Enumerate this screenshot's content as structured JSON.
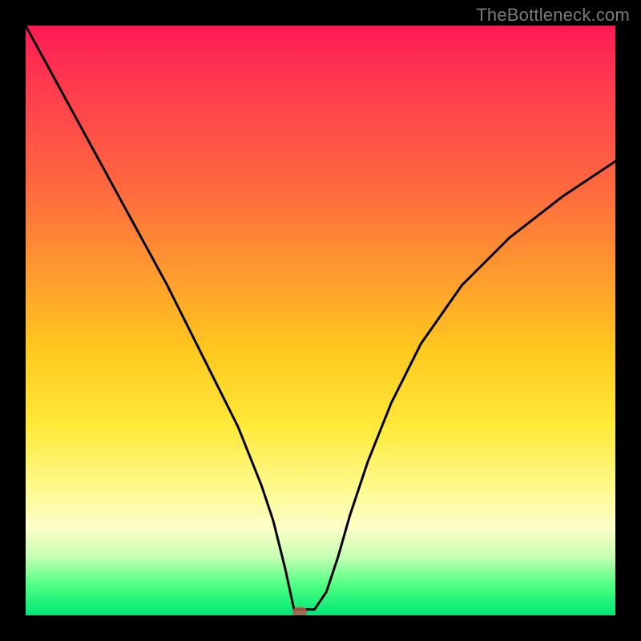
{
  "watermark": "TheBottleneck.com",
  "chart_data": {
    "type": "line",
    "title": "",
    "xlabel": "",
    "ylabel": "",
    "xlim": [
      0,
      100
    ],
    "ylim": [
      0,
      100
    ],
    "grid": false,
    "series": [
      {
        "name": "bottleneck-curve",
        "x": [
          0,
          6,
          12,
          18,
          24,
          30,
          36,
          40,
          42,
          44,
          45.5,
          47,
          49,
          51,
          53,
          55,
          58,
          62,
          67,
          74,
          82,
          91,
          100
        ],
        "values": [
          100,
          89,
          78,
          67,
          56,
          44,
          32,
          22,
          16,
          8,
          1,
          1,
          1,
          4,
          10,
          17,
          26,
          36,
          46,
          56,
          64,
          71,
          77
        ]
      }
    ],
    "marker": {
      "x": 46.5,
      "y": 0.6
    },
    "gradient_stops": [
      {
        "pct": 0,
        "color": "#ff1a55"
      },
      {
        "pct": 28,
        "color": "#ff6a3e"
      },
      {
        "pct": 55,
        "color": "#ffc81e"
      },
      {
        "pct": 78,
        "color": "#fff98a"
      },
      {
        "pct": 95,
        "color": "#4cff82"
      },
      {
        "pct": 100,
        "color": "#00e676"
      }
    ]
  }
}
